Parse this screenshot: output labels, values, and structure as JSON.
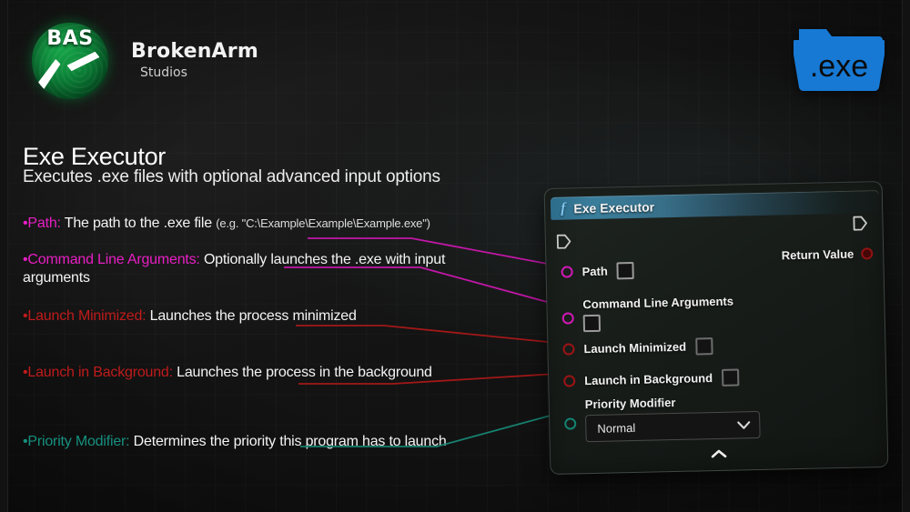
{
  "brand": {
    "logo_text": "BAS",
    "name": "BrokenArm",
    "sub": "Studios",
    "logo_icon": "broken-arm-bones-icon"
  },
  "file_icon": {
    "label": ".exe",
    "icon": "exe-folder-icon",
    "color": "#1779d4"
  },
  "heading": {
    "title": "Exe Executor",
    "subtitle": "Executes .exe files with optional advanced input options"
  },
  "descriptions": [
    {
      "bullet": "•",
      "key": "Path:",
      "value": "The path to the .exe file",
      "note": "(e.g. \"C:\\Example\\Example\\Example.exe\")",
      "color": "#e81ec4"
    },
    {
      "bullet": "•",
      "key": "Command Line Arguments:",
      "value": "Optionally launches the .exe with input arguments",
      "note": "",
      "color": "#e81ec4"
    },
    {
      "bullet": "•",
      "key": "Launch Minimized:",
      "value": "Launches the process minimized",
      "note": "",
      "color": "#c01b1b"
    },
    {
      "bullet": "•",
      "key": "Launch in Background:",
      "value": "Launches the process in the background",
      "note": "",
      "color": "#c01b1b"
    },
    {
      "bullet": "•",
      "key": "Priority Modifier:",
      "value": "Determines the priority this program has to launch",
      "note": "",
      "color": "#16907f"
    }
  ],
  "node": {
    "function_icon": "f",
    "title": "Exe Executor",
    "exec_in_icon": "exec-pin-icon",
    "exec_out_icon": "exec-pin-icon",
    "pins": [
      {
        "label": "Path",
        "type": "string",
        "color": "#d118b4",
        "widget": "checkbox"
      },
      {
        "label": "Command Line Arguments",
        "type": "string",
        "color": "#d118b4",
        "widget": "checkbox"
      },
      {
        "label": "Launch Minimized",
        "type": "boolean",
        "color": "#9c1414",
        "widget": "checkbox"
      },
      {
        "label": "Launch in Background",
        "type": "boolean",
        "color": "#9c1414",
        "widget": "checkbox"
      },
      {
        "label": "Priority Modifier",
        "type": "enum",
        "color": "#138271",
        "widget": "dropdown"
      }
    ],
    "return": {
      "label": "Return Value",
      "color": "#8f1212"
    },
    "dropdown": {
      "value": "Normal",
      "chevron": "chevron-down-icon"
    },
    "collapse_icon": "chevron-up-icon",
    "collapse_glyph": "⌃"
  }
}
